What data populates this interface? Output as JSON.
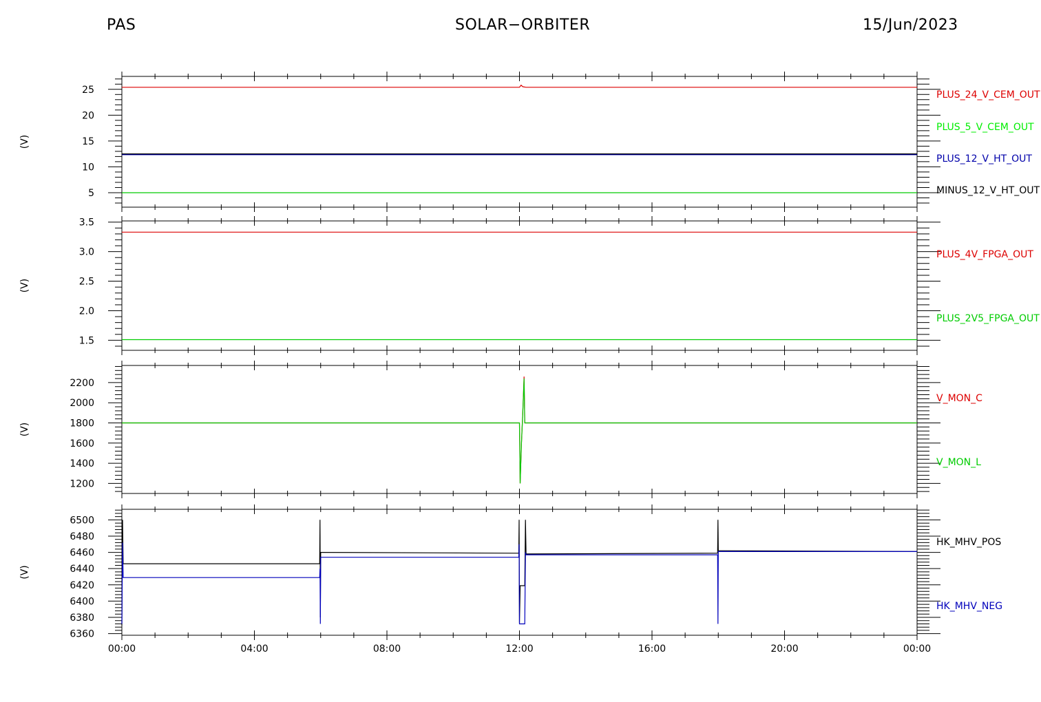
{
  "header": {
    "left": "PAS",
    "center": "SOLAR−ORBITER",
    "right": "15/Jun/2023"
  },
  "chart_data": [
    {
      "type": "line",
      "ylabel": "(V)",
      "ylim": [
        2.2,
        27.5
      ],
      "yticks": [
        5,
        10,
        15,
        20,
        25
      ],
      "ytick_labels": [
        "5",
        "10",
        "15",
        "20",
        "25"
      ],
      "xlim": [
        0,
        24
      ],
      "series": [
        {
          "name": "PLUS_24_V_CEM_OUT",
          "color": "#dd0000",
          "x": [
            0,
            12.0,
            12.05,
            12.1,
            12.2,
            24
          ],
          "y": [
            25.4,
            25.4,
            25.8,
            25.5,
            25.4,
            25.4
          ]
        },
        {
          "name": "PLUS_5_V_CEM_OUT",
          "color": "#00ee00",
          "x": [],
          "y": []
        },
        {
          "name": "PLUS_12_V_HT_OUT",
          "color": "#0000aa",
          "x": [
            0,
            24
          ],
          "y": [
            12.4,
            12.4
          ]
        },
        {
          "name": "MINUS_12_V_HT_OUT",
          "color": "#000000",
          "x": [
            0,
            24
          ],
          "y": [
            12.5,
            12.5
          ]
        },
        {
          "name": "",
          "color": "#00cc00",
          "x": [
            0,
            24
          ],
          "y": [
            5.0,
            5.0
          ]
        }
      ]
    },
    {
      "type": "line",
      "ylabel": "(V)",
      "ylim": [
        1.33,
        3.52
      ],
      "yticks": [
        1.5,
        2.0,
        2.5,
        3.0,
        3.5
      ],
      "ytick_labels": [
        "1.5",
        "2.0",
        "2.5",
        "3.0",
        "3.5"
      ],
      "xlim": [
        0,
        24
      ],
      "series": [
        {
          "name": "PLUS_4V_FPGA_OUT",
          "color": "#dd0000",
          "x": [
            0,
            24
          ],
          "y": [
            3.33,
            3.33
          ]
        },
        {
          "name": "PLUS_2V5_FPGA_OUT",
          "color": "#00cc00",
          "x": [
            0,
            24
          ],
          "y": [
            1.51,
            1.51
          ]
        }
      ]
    },
    {
      "type": "line",
      "ylabel": "(V)",
      "ylim": [
        1100,
        2370
      ],
      "yticks": [
        1200,
        1400,
        1600,
        1800,
        2000,
        2200
      ],
      "ytick_labels": [
        "1200",
        "1400",
        "1600",
        "1800",
        "2000",
        "2200"
      ],
      "xlim": [
        0,
        24
      ],
      "series": [
        {
          "name": "V_MON_C",
          "color": "#dd0000",
          "x": [
            0,
            12.0,
            12.02,
            12.06,
            12.1,
            12.14,
            12.16,
            12.2,
            24
          ],
          "y": [
            1800,
            1800,
            1200,
            1600,
            1900,
            2260,
            1800,
            1800,
            1800
          ]
        },
        {
          "name": "V_MON_L",
          "color": "#00cc00",
          "x": [
            0,
            12.0,
            12.02,
            12.06,
            12.1,
            12.14,
            12.16,
            12.2,
            24
          ],
          "y": [
            1800,
            1800,
            1200,
            1600,
            1900,
            2240,
            1800,
            1800,
            1800
          ]
        }
      ]
    },
    {
      "type": "line",
      "ylabel": "(V)",
      "ylim": [
        6358,
        6513
      ],
      "yticks": [
        6360,
        6380,
        6400,
        6420,
        6440,
        6460,
        6480,
        6500
      ],
      "ytick_labels": [
        "6360",
        "6380",
        "6400",
        "6420",
        "6440",
        "6460",
        "6480",
        "6500"
      ],
      "xlim": [
        0,
        24
      ],
      "xticks": [
        0,
        4,
        8,
        12,
        16,
        20,
        24
      ],
      "xtick_labels": [
        "00:00",
        "04:00",
        "08:00",
        "12:00",
        "16:00",
        "20:00",
        "00:00"
      ],
      "series": [
        {
          "name": "HK_MHV_POS",
          "color": "#000000",
          "x": [
            0,
            0.02,
            0.04,
            0.06,
            5.97,
            5.98,
            5.99,
            6.0,
            6.02,
            11.98,
            11.99,
            12.0,
            12.02,
            12.04,
            12.16,
            12.18,
            12.2,
            12.22,
            17.98,
            17.99,
            18.0,
            18.02,
            24
          ],
          "y": [
            6370,
            6500,
            6446,
            6446,
            6446,
            6500,
            6380,
            6460,
            6460,
            6459,
            6500,
            6373,
            6419,
            6419,
            6419,
            6500,
            6458,
            6458,
            6459,
            6500,
            6462,
            6462,
            6461
          ]
        },
        {
          "name": "HK_MHV_NEG",
          "color": "#0000bb",
          "x": [
            0,
            0.02,
            0.04,
            5.97,
            5.98,
            5.99,
            6.0,
            6.02,
            11.98,
            11.99,
            12.0,
            12.02,
            12.04,
            12.16,
            12.18,
            12.2,
            12.22,
            17.98,
            17.99,
            18.0,
            18.02,
            24
          ],
          "y": [
            6372,
            6472,
            6429,
            6429,
            6440,
            6372,
            6454,
            6454,
            6454,
            6470,
            6372,
            6372,
            6372,
            6372,
            6460,
            6457,
            6457,
            6457,
            6372,
            6461,
            6461,
            6461
          ]
        }
      ]
    }
  ]
}
